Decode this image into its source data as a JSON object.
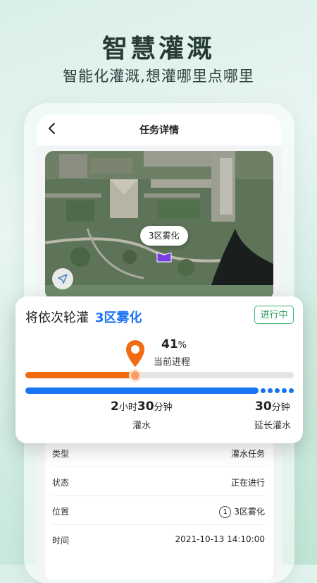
{
  "promo": {
    "title": "智慧灌溉",
    "subtitle": "智能化灌溉,想灌哪里点哪里"
  },
  "app": {
    "page_title": "任务详情"
  },
  "map": {
    "zone_tag": "3区雾化"
  },
  "card": {
    "prefix": "将依次轮灌",
    "zone": "3区雾化",
    "status": "进行中",
    "progress_value": "41",
    "progress_unit": "%",
    "progress_label": "当前进程",
    "progress_fraction": 0.41,
    "water_time": {
      "h": "2",
      "h_unit": "小时",
      "m": "30",
      "m_unit": "分钟",
      "label": "灌水"
    },
    "extend_time": {
      "m": "30",
      "m_unit": "分钟",
      "label": "延长灌水"
    }
  },
  "details": [
    {
      "key": "类型",
      "value": "灌水任务"
    },
    {
      "key": "状态",
      "value": "正在进行"
    },
    {
      "key": "位置",
      "index": "1",
      "value": "3区雾化"
    },
    {
      "key": "时间",
      "value": "2021-10-13 14:10:00"
    }
  ],
  "colors": {
    "accent_blue": "#1a73f0",
    "accent_orange": "#f26b10",
    "status_green": "#2e9e5b"
  }
}
